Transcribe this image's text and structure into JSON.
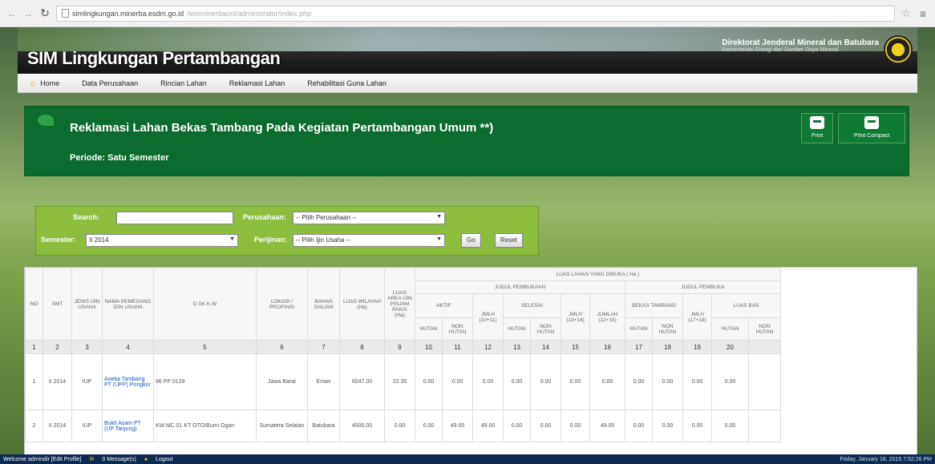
{
  "browser": {
    "url_host": "simlingkungan.minerba.esdm.go.id",
    "url_path": "/simminerbaonl/adminstrator/index.php"
  },
  "header": {
    "site_title": "SIM Lingkungan Pertambangan",
    "ministry_line1": "Direktorat Jenderal Mineral dan Batubara",
    "ministry_line2": "Kementerian Energi dan Sumber Daya Mineral"
  },
  "menu": [
    {
      "label": "Home"
    },
    {
      "label": "Data Perusahaan"
    },
    {
      "label": "Rincian Lahan"
    },
    {
      "label": "Reklamasi Lahan"
    },
    {
      "label": "Rehabilitasi Guna Lahan"
    }
  ],
  "banner": {
    "title": "Reklamasi Lahan Bekas Tambang Pada Kegiatan Pertambangan Umum **)",
    "period": "Periode: Satu Semester",
    "print_label": "Print",
    "print_compact_label": "Print Compact"
  },
  "filter": {
    "search_label": "Search:",
    "search_value": "",
    "perusahaan_label": "Perusahaan:",
    "perusahaan_value": "-- Pilih Perusahaan --",
    "semester_label": "Semester:",
    "semester_value": "II 2014",
    "perijinan_label": "Perijinan:",
    "perijinan_value": "-- Pilih Ijin Usaha --",
    "go_label": "Go",
    "reset_label": "Reset"
  },
  "table": {
    "header_top": "LUAS LAHAN YANG DIBUKA ( Ha )",
    "group_a": "JUDUL PEMBUKAAN",
    "group_b": "JUDUL PEMBUKA",
    "cols": {
      "no": "NO",
      "smt": "SMT",
      "jenis": "JENIS IJIN USAHA",
      "nama": "NAMA PEMEGANG IZIN USAHA",
      "sk": "D SK K.W",
      "lokasi": "LOKASI / PROPINSI",
      "bahan": "BAHAN GALIAN",
      "luas_wil": "LUAS WILAYAH (Ha)",
      "luas_area": "LUAS AREA IJIN PINJAM PAKAI (Ha)",
      "aktif": "AKTIF",
      "selesai": "SELESAI",
      "jmlh_a": "JMLH (10+11)",
      "jmlh_b": "JMLH (13+14)",
      "jumlah": "JUMLAH (12+15)",
      "bekas": "BEKAS TAMBANG",
      "jmlh_c": "JMLH (17+18)",
      "luas_bas": "LUAS BAS",
      "hutan": "HUTAN",
      "non_hutan": "NON HUTAN"
    },
    "col_numbers": [
      "1",
      "2",
      "3",
      "4",
      "5",
      "6",
      "7",
      "8",
      "9",
      "10",
      "11",
      "12",
      "13",
      "14",
      "15",
      "16",
      "17",
      "18",
      "19",
      "20"
    ],
    "rows": [
      {
        "no": "1",
        "smt": "II 2014",
        "jenis": "IUP",
        "nama": "Aneka Tambang PT (UPP) Pongkor",
        "sk": "96 PP 0139",
        "lokasi": "Jawa Barat",
        "bahan": "Emas",
        "v8": "6047.00",
        "v9": "22.35",
        "v10": "0.00",
        "v11": "0.00",
        "v12": "0.00",
        "v13": "0.00",
        "v14": "0.00",
        "v15": "0.00",
        "v16": "0.00",
        "v17": "0.00",
        "v18": "0.00",
        "v19": "0.00",
        "v20": "0.00"
      },
      {
        "no": "2",
        "smt": "II 2014",
        "jenis": "IUP",
        "nama": "Bukit Asam PT (UP Tanjung)",
        "sk": "KW.MC.01 KT OTO/Bumi Ogan",
        "lokasi": "Sumatera Selatan",
        "bahan": "Batubara",
        "v8": "4500.00",
        "v9": "0.00",
        "v10": "0.00",
        "v11": "49.00",
        "v12": "49.00",
        "v13": "0.00",
        "v14": "0.00",
        "v15": "0.00",
        "v16": "49.00",
        "v17": "0.00",
        "v18": "0.00",
        "v19": "0.00",
        "v20": "0.00"
      }
    ]
  },
  "taskbar": {
    "welcome": "Welcome admindir [Edit Profile]",
    "messages": "0 Message(s)",
    "logout": "Logout",
    "clock": "Friday, January 16, 2015 7:52:26 PM"
  }
}
